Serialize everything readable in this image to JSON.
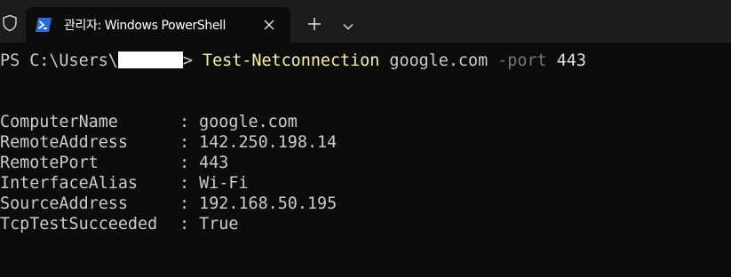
{
  "window": {
    "tab_title": "관리자: Windows PowerShell",
    "icons": {
      "shield": "shield-icon",
      "powershell": "powershell-icon",
      "close": "close-icon",
      "new_tab": "plus-icon",
      "dropdown": "chevron-down-icon"
    }
  },
  "terminal": {
    "prompt_prefix": "PS C:\\Users\\",
    "prompt_suffix": ">",
    "command": "Test-Netconnection",
    "argument": "google.com",
    "parameter": "-port",
    "parameter_value": "443",
    "output": [
      {
        "key": "ComputerName",
        "value": "google.com"
      },
      {
        "key": "RemoteAddress",
        "value": "142.250.198.14"
      },
      {
        "key": "RemotePort",
        "value": "443"
      },
      {
        "key": "InterfaceAlias",
        "value": "Wi-Fi"
      },
      {
        "key": "SourceAddress",
        "value": "192.168.50.195"
      },
      {
        "key": "TcpTestSucceeded",
        "value": "True"
      }
    ],
    "separator": ": "
  },
  "colors": {
    "background": "#0c0c0c",
    "tabbar": "#1c1c1c",
    "text": "#cccccc",
    "command": "#f9f1a5",
    "parameter": "#767676"
  }
}
